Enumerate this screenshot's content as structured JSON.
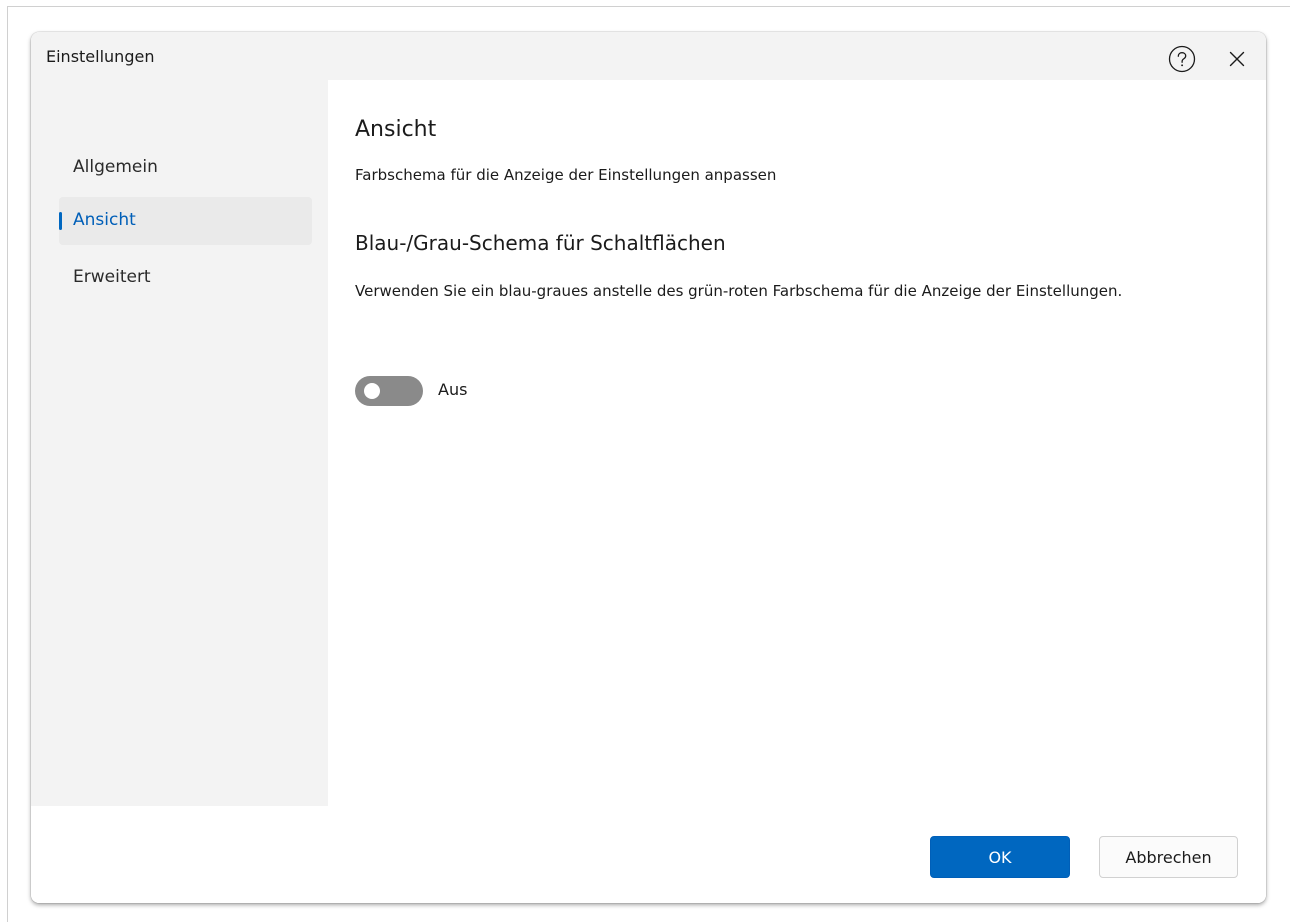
{
  "window": {
    "title": "Einstellungen",
    "help_icon": "help-circle-icon",
    "close_icon": "close-icon"
  },
  "sidebar": {
    "items": [
      {
        "label": "Allgemein",
        "selected": false
      },
      {
        "label": "Ansicht",
        "selected": true
      },
      {
        "label": "Erweitert",
        "selected": false
      }
    ]
  },
  "content": {
    "title": "Ansicht",
    "description": "Farbschema für die Anzeige der Einstellungen anpassen",
    "setting": {
      "title": "Blau-/Grau-Schema für Schaltflächen",
      "description": "Verwenden Sie ein blau-graues anstelle des grün-roten Farbschema für die Anzeige der Einstellungen.",
      "toggle_on": false,
      "toggle_state_label": "Aus"
    }
  },
  "footer": {
    "ok_label": "OK",
    "cancel_label": "Abbrechen"
  },
  "colors": {
    "accent": "#0067c0",
    "toggle_off": "#8a8a8a",
    "sidebar_bg": "#f3f3f3"
  }
}
